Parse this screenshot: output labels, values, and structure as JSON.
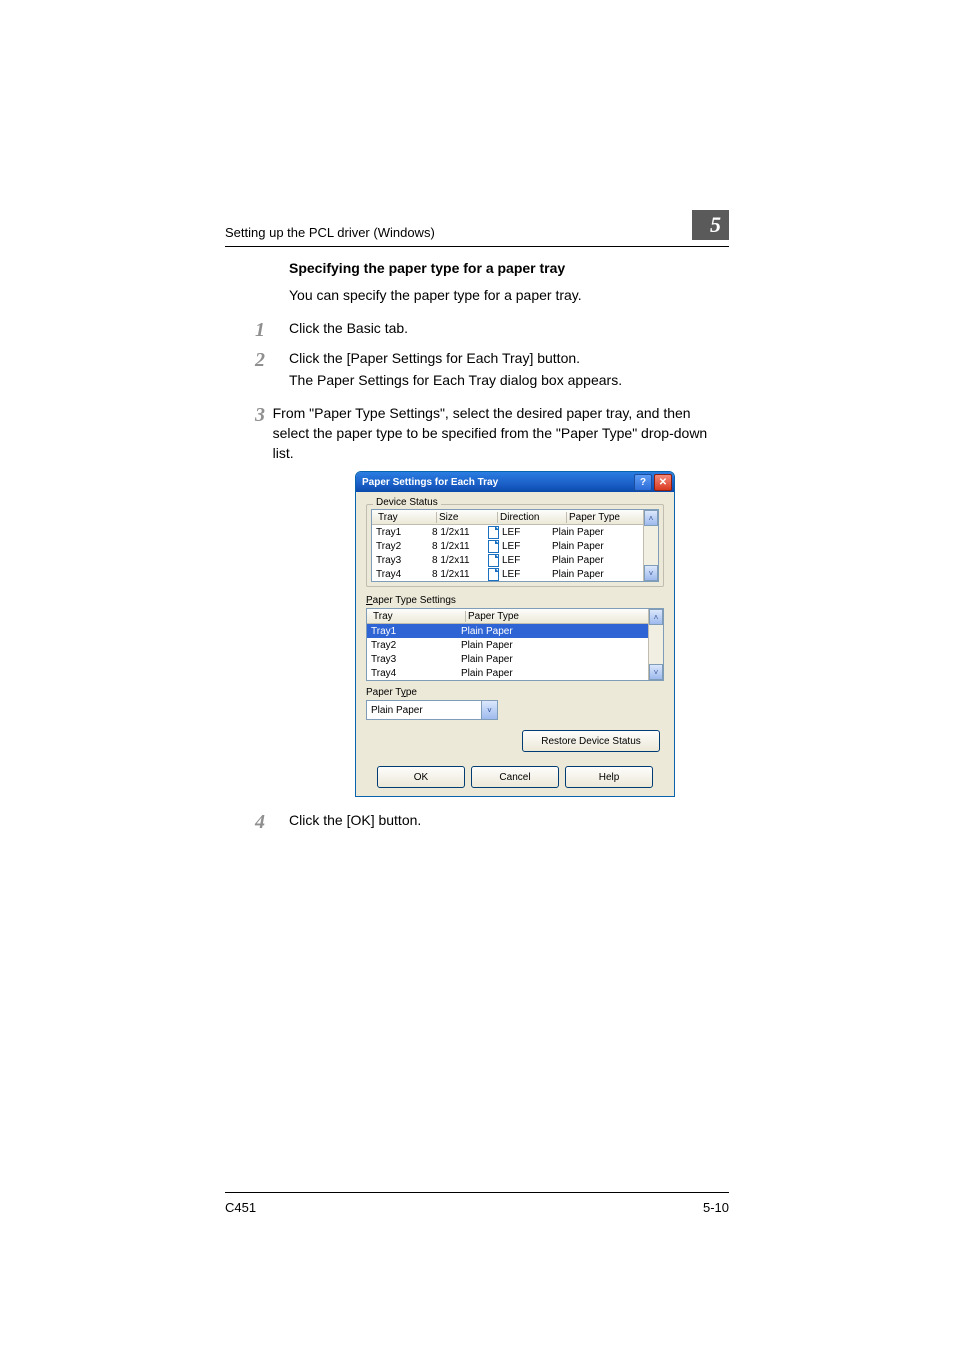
{
  "running_head": "Setting up the PCL driver (Windows)",
  "chapter_number": "5",
  "heading": "Specifying the paper type for a paper tray",
  "intro_paragraph": "You can specify the paper type for a paper tray.",
  "steps": [
    {
      "num": "1",
      "text": "Click the Basic tab."
    },
    {
      "num": "2",
      "text": "Click the [Paper Settings for Each Tray] button.",
      "sub": "The Paper Settings for Each Tray dialog box appears."
    },
    {
      "num": "3",
      "text": "From \"Paper Type Settings\", select the desired paper tray, and then select the paper type to be specified from the \"Paper Type\" drop-down list."
    },
    {
      "num": "4",
      "text": "Click the [OK] button."
    }
  ],
  "dialog": {
    "title": "Paper Settings for Each Tray",
    "help_glyph": "?",
    "close_glyph": "✕",
    "group_device_status": "Device Status",
    "device_status_cols": {
      "tray": "Tray",
      "size": "Size",
      "direction": "Direction",
      "paper_type": "Paper Type"
    },
    "device_status_rows": [
      {
        "tray": "Tray1",
        "size": "8 1/2x11",
        "direction": "LEF",
        "paper_type": "Plain Paper"
      },
      {
        "tray": "Tray2",
        "size": "8 1/2x11",
        "direction": "LEF",
        "paper_type": "Plain Paper"
      },
      {
        "tray": "Tray3",
        "size": "8 1/2x11",
        "direction": "LEF",
        "paper_type": "Plain Paper"
      },
      {
        "tray": "Tray4",
        "size": "8 1/2x11",
        "direction": "LEF",
        "paper_type": "Plain Paper"
      }
    ],
    "paper_type_settings_label_prefix": "P",
    "paper_type_settings_label_rest": "aper Type Settings",
    "pts_cols": {
      "tray": "Tray",
      "paper_type": "Paper Type"
    },
    "pts_rows": [
      {
        "tray": "Tray1",
        "paper_type": "Plain Paper",
        "selected": true
      },
      {
        "tray": "Tray2",
        "paper_type": "Plain Paper"
      },
      {
        "tray": "Tray3",
        "paper_type": "Plain Paper"
      },
      {
        "tray": "Tray4",
        "paper_type": "Plain Paper"
      }
    ],
    "paper_type_label_prefix": "Paper T",
    "paper_type_label_mid_ul": "y",
    "paper_type_label_rest": "pe",
    "paper_type_value": "Plain Paper",
    "restore_prefix": "R",
    "restore_rest": "estore Device Status",
    "ok": "OK",
    "cancel": "Cancel",
    "help_prefix": "H",
    "help_rest": "elp",
    "scroll_up": "˄",
    "scroll_down": "˅",
    "combo_chevron": "˅"
  },
  "footer_left": "C451",
  "footer_right": "5-10"
}
